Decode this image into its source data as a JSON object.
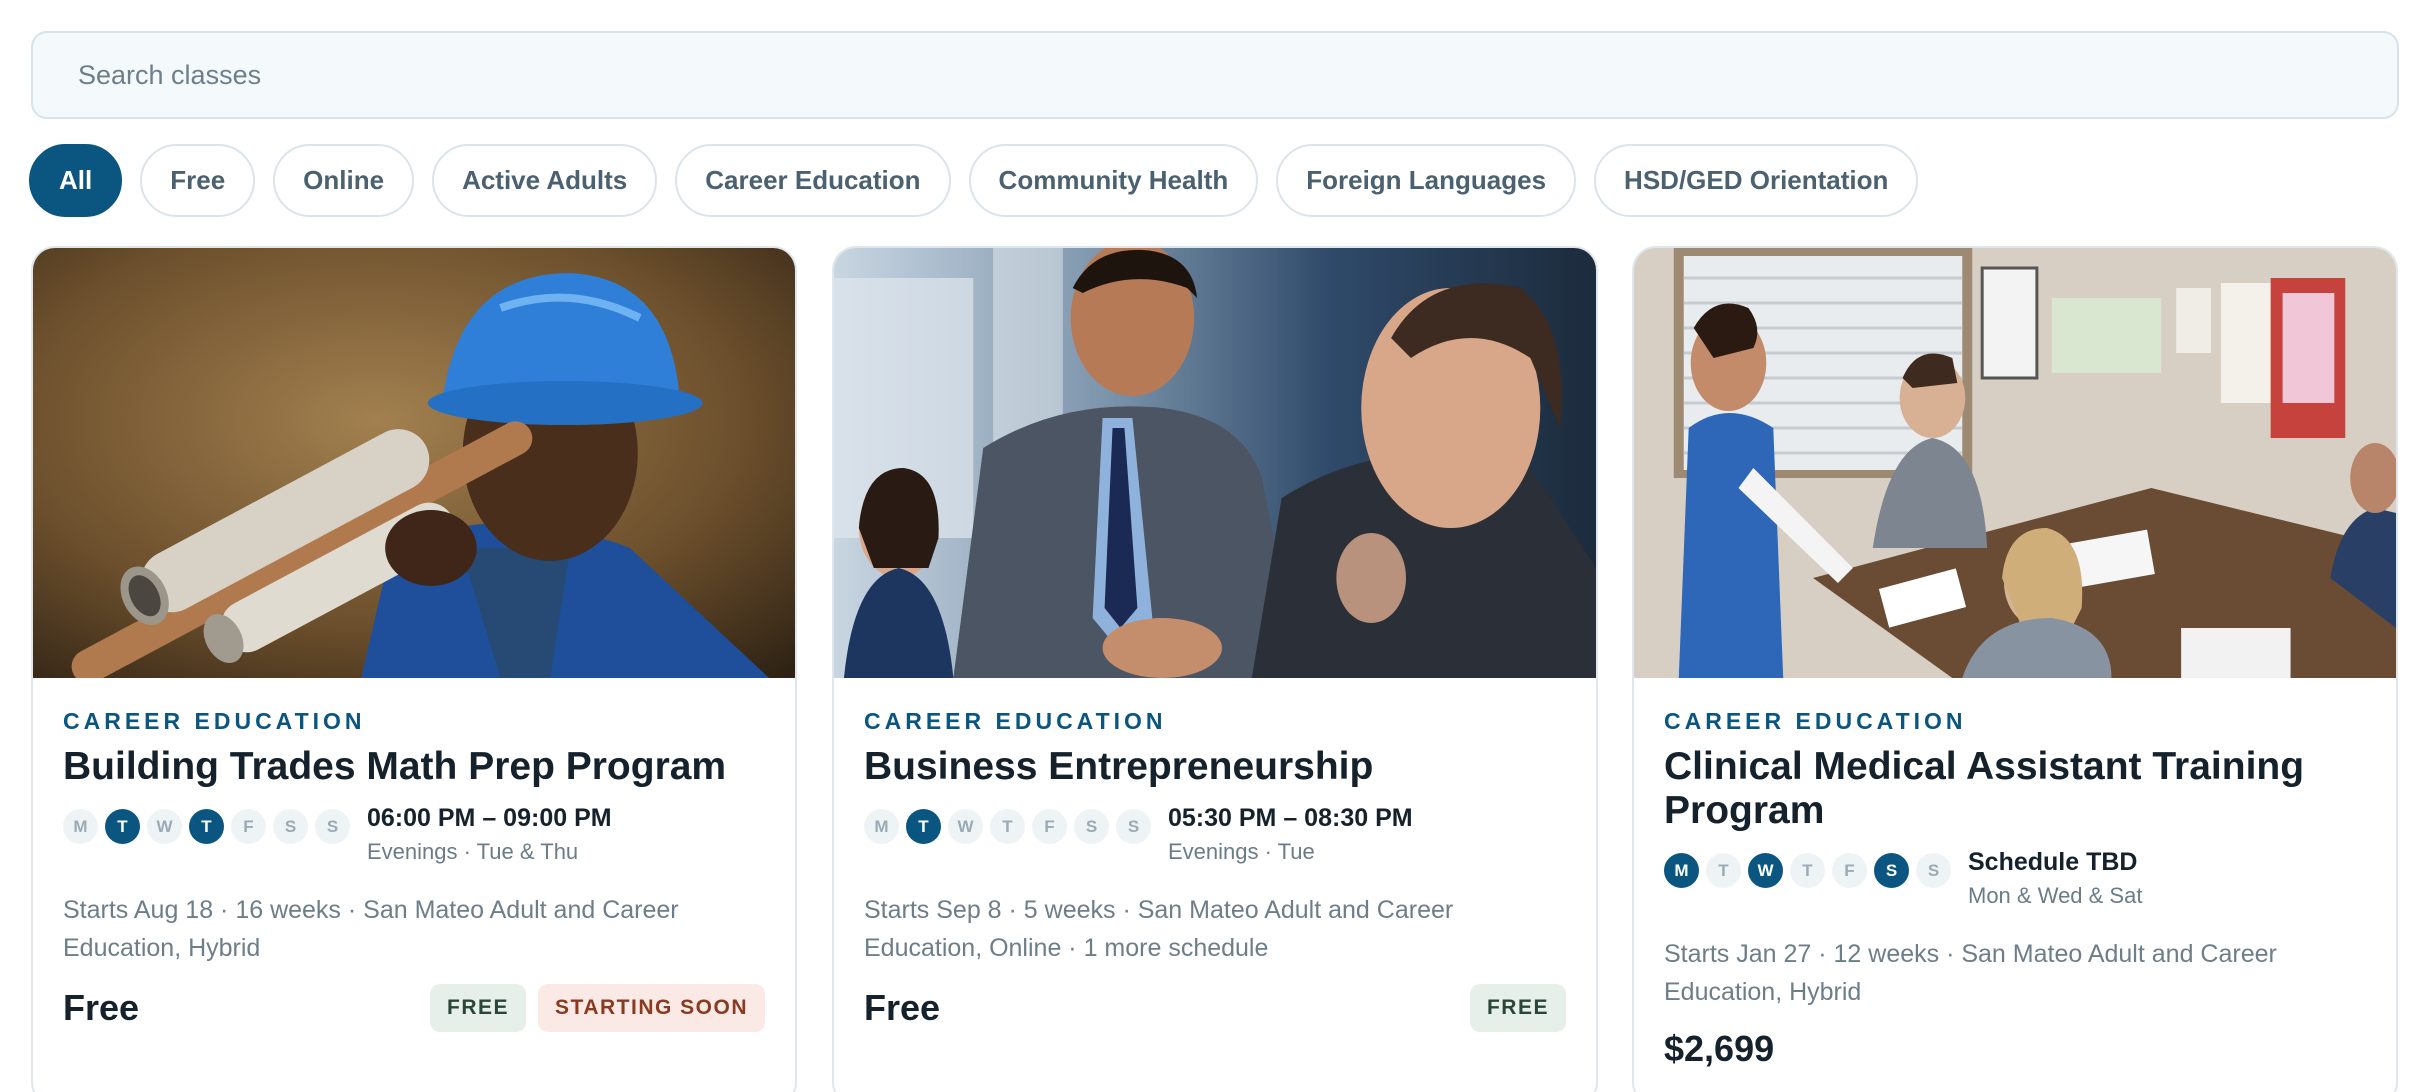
{
  "search": {
    "placeholder": "Search classes"
  },
  "filters": [
    "All",
    "Free",
    "Online",
    "Active Adults",
    "Career Education",
    "Community Health",
    "Foreign Languages",
    "HSD/GED Orientation"
  ],
  "active_filter": "All",
  "day_letters": [
    "M",
    "T",
    "W",
    "T",
    "F",
    "S",
    "S"
  ],
  "cards": [
    {
      "category": "CAREER EDUCATION",
      "title": "Building Trades Math Prep Program",
      "active_days": [
        1,
        3
      ],
      "time": "06:00 PM – 09:00 PM",
      "subtitle": "Evenings · Tue & Thu",
      "meta": "Starts Aug 18 · 16 weeks · San Mateo Adult and Career Education, Hybrid",
      "price": "Free",
      "badges": [
        "FREE",
        "STARTING SOON"
      ]
    },
    {
      "category": "CAREER EDUCATION",
      "title": "Business Entrepreneurship",
      "active_days": [
        1
      ],
      "time": "05:30 PM – 08:30 PM",
      "subtitle": "Evenings · Tue",
      "meta": "Starts Sep 8 · 5 weeks · San Mateo Adult and Career Education, Online · 1 more schedule",
      "price": "Free",
      "badges": [
        "FREE"
      ]
    },
    {
      "category": "CAREER EDUCATION",
      "title": "Clinical Medical Assistant Training Program",
      "active_days": [
        0,
        2,
        5
      ],
      "time": "Schedule TBD",
      "subtitle": "Mon & Wed & Sat",
      "meta": "Starts Jan 27 · 12 weeks · San Mateo Adult and Career Education, Hybrid",
      "price": "$2,699",
      "badges": []
    }
  ]
}
